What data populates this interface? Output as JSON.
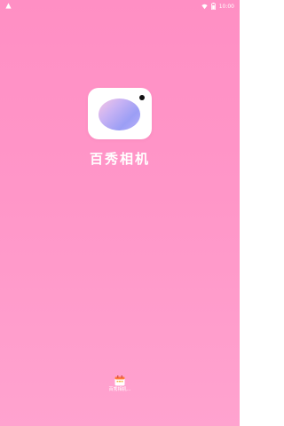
{
  "status_bar": {
    "time": "10:00",
    "left_icon": "alert-triangle-icon",
    "wifi_icon": "wifi-icon",
    "battery_icon": "battery-icon"
  },
  "splash": {
    "app_name": "百秀相机",
    "icon": "camera-logo-icon",
    "bottom_label": "百秀相机...",
    "bottom_icon": "calendar-icon"
  },
  "colors": {
    "background_top": "#ff8fc4",
    "background_bottom": "#ffa3cf",
    "text": "#ffffff"
  }
}
